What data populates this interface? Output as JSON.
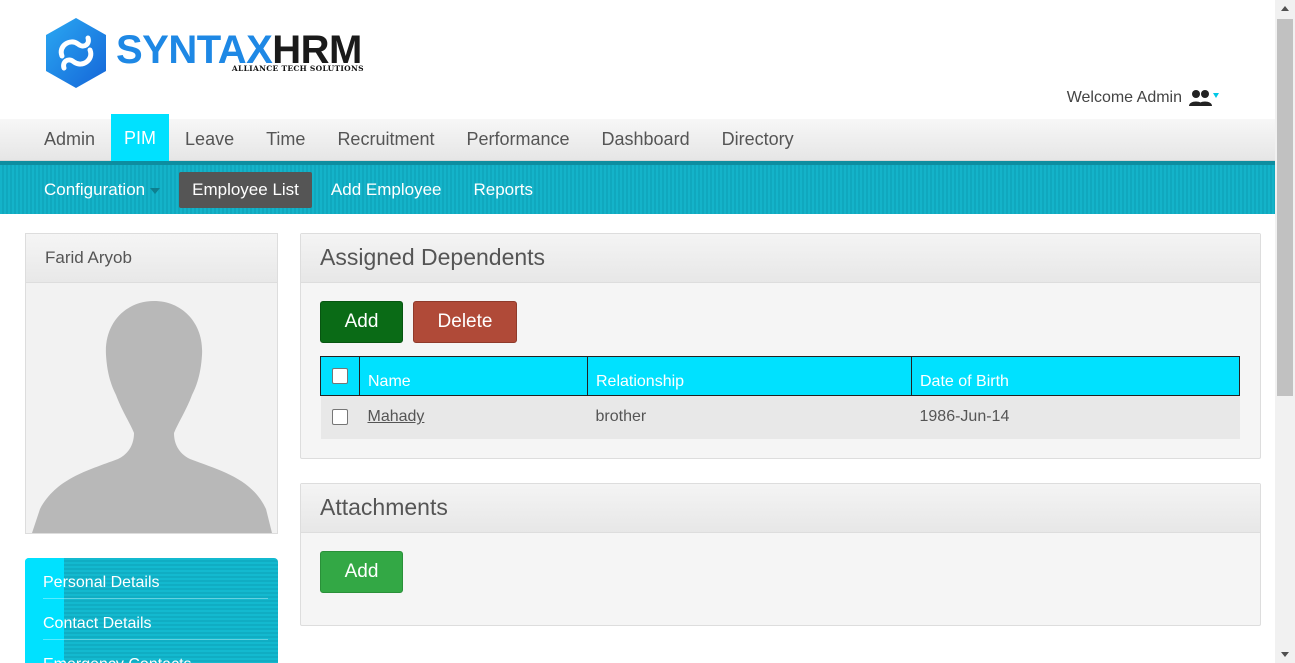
{
  "header": {
    "logo_icon": "syntax-hrm-logo-icon",
    "logo_part1": "SYNTAX",
    "logo_part2": "HRM",
    "logo_tagline": "ALLIANCE TECH SOLUTIONS",
    "welcome_text": "Welcome Admin",
    "user_icon": "users-icon"
  },
  "main_nav": [
    "Admin",
    "PIM",
    "Leave",
    "Time",
    "Recruitment",
    "Performance",
    "Dashboard",
    "Directory"
  ],
  "main_nav_active": "PIM",
  "sub_nav": {
    "configuration": "Configuration",
    "employee_list": "Employee List",
    "add_employee": "Add Employee",
    "reports": "Reports"
  },
  "profile": {
    "name": "Farid Aryob",
    "photo_icon": "avatar-placeholder"
  },
  "side_menu": [
    "Personal Details",
    "Contact Details",
    "Emergency Contacts"
  ],
  "dependents": {
    "title": "Assigned Dependents",
    "add_label": "Add",
    "delete_label": "Delete",
    "columns": [
      "Name",
      "Relationship",
      "Date of Birth"
    ],
    "rows": [
      {
        "name": "Mahady",
        "relationship": "brother",
        "dob": "1986-Jun-14"
      }
    ]
  },
  "attachments": {
    "title": "Attachments",
    "add_label": "Add"
  },
  "colors": {
    "accent_cyan": "#00e1ff",
    "subnav_teal": "#14b3c9",
    "add_green_dark": "#0a6b16",
    "delete_red": "#b04a38",
    "add_green": "#33a845"
  }
}
